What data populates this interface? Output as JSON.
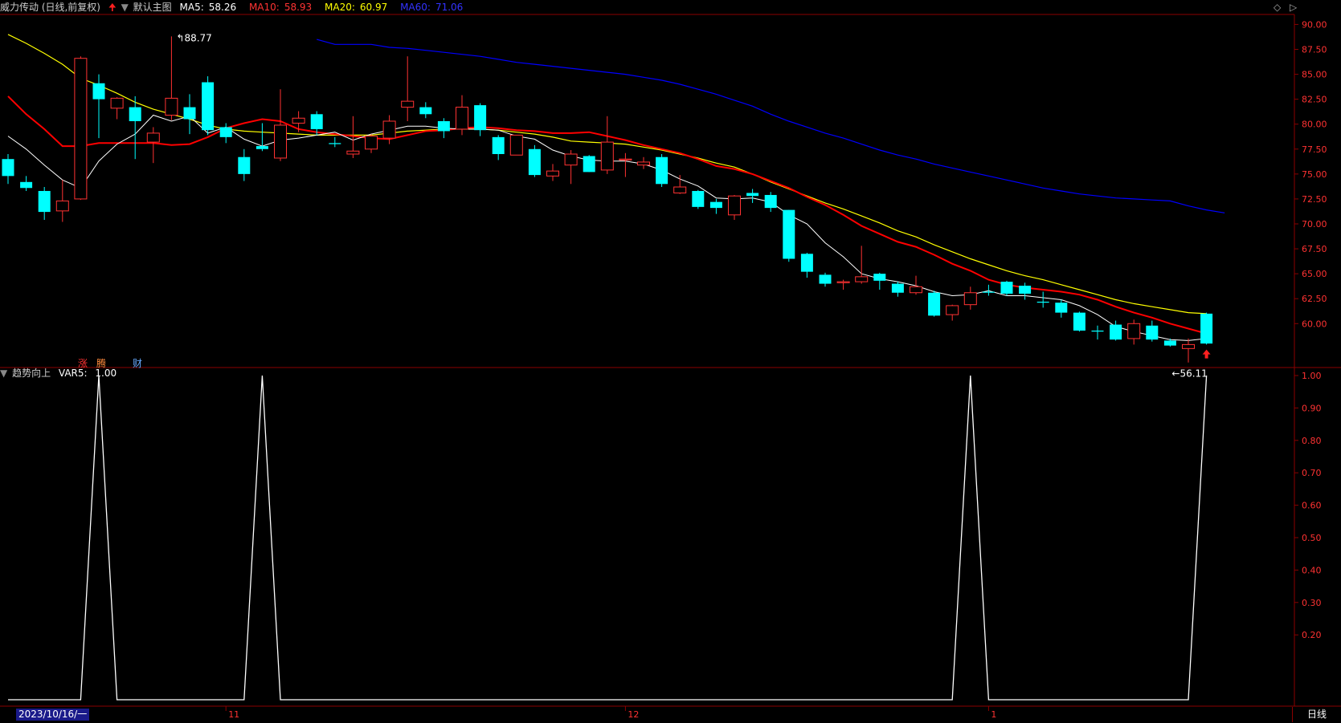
{
  "header": {
    "stock_name": "威力传动 (日线,前复权)",
    "main_label": "默认主图",
    "indicators": [
      {
        "label": "MA5:",
        "value": "58.26",
        "color": "#ffffff"
      },
      {
        "label": "MA10:",
        "value": "58.93",
        "color": "#ff3333"
      },
      {
        "label": "MA20:",
        "value": "60.97",
        "color": "#ffff00"
      },
      {
        "label": "MA60:",
        "value": "71.06",
        "color": "#3333ff"
      }
    ]
  },
  "sub_header": {
    "name": "趋势向上",
    "var_label": "VAR5:",
    "var_value": "1.00"
  },
  "markers": {
    "zhang": "涨",
    "teng": "腾",
    "cai": "财"
  },
  "footer": {
    "date": "2023/10/16/一",
    "period": "日线"
  },
  "colors": {
    "up": "#ff3232",
    "down": "#00ffff",
    "ma5": "#ffffff",
    "ma10": "#ff0000",
    "ma20": "#ffff00",
    "ma60": "#0000ff",
    "grid": "#8b0000"
  },
  "chart_data": [
    {
      "type": "candlestick",
      "y_ticks": [
        "90.00",
        "87.50",
        "85.00",
        "82.50",
        "80.00",
        "77.50",
        "75.00",
        "72.50",
        "70.00",
        "67.50",
        "65.00",
        "62.50",
        "60.00"
      ],
      "ylim": [
        56.0,
        91.0
      ],
      "annotations": [
        {
          "text": "88.77",
          "index": 9,
          "value": 88.77
        },
        {
          "text": "56.11",
          "index": 64,
          "value": 56.11
        }
      ],
      "x_labels": [
        {
          "text": "11",
          "index": 12
        },
        {
          "text": "12",
          "index": 34
        },
        {
          "text": "1",
          "index": 54
        }
      ],
      "candles": [
        [
          76.5,
          74.8,
          77.0,
          74.0
        ],
        [
          74.2,
          73.6,
          74.8,
          73.3
        ],
        [
          73.3,
          71.2,
          73.7,
          70.4
        ],
        [
          71.3,
          72.3,
          74.4,
          70.2
        ],
        [
          72.5,
          86.6,
          86.8,
          72.4
        ],
        [
          84.1,
          82.5,
          85.0,
          78.6
        ],
        [
          81.6,
          82.6,
          82.7,
          80.5
        ],
        [
          81.7,
          80.3,
          82.8,
          76.5
        ],
        [
          78.2,
          79.1,
          79.7,
          76.1
        ],
        [
          80.9,
          82.6,
          88.8,
          80.4
        ],
        [
          81.7,
          80.5,
          83.0,
          79.0
        ],
        [
          84.2,
          79.4,
          84.8,
          78.9
        ],
        [
          79.7,
          78.7,
          80.1,
          78.1
        ],
        [
          76.7,
          75.0,
          77.5,
          74.3
        ],
        [
          77.8,
          77.5,
          80.1,
          77.3
        ],
        [
          76.6,
          79.9,
          83.5,
          76.3
        ],
        [
          80.1,
          80.6,
          81.3,
          79.2
        ],
        [
          81.0,
          79.5,
          81.3,
          78.9
        ],
        [
          78.1,
          78.0,
          78.7,
          77.7
        ],
        [
          77.0,
          77.3,
          80.8,
          76.6
        ],
        [
          77.5,
          78.8,
          79.0,
          77.1
        ],
        [
          78.6,
          80.3,
          80.9,
          78.0
        ],
        [
          81.7,
          82.3,
          86.8,
          80.3
        ],
        [
          81.7,
          81.0,
          82.2,
          80.6
        ],
        [
          80.3,
          79.3,
          80.6,
          78.6
        ],
        [
          79.5,
          81.7,
          82.9,
          78.9
        ],
        [
          81.9,
          79.4,
          82.1,
          78.8
        ],
        [
          78.7,
          77.0,
          78.9,
          76.4
        ],
        [
          76.9,
          78.9,
          78.9,
          76.9
        ],
        [
          77.5,
          74.9,
          77.9,
          74.7
        ],
        [
          74.8,
          75.3,
          76.0,
          74.3
        ],
        [
          75.9,
          77.0,
          77.4,
          74.0
        ],
        [
          76.8,
          75.2,
          76.9,
          75.2
        ],
        [
          75.4,
          78.2,
          80.8,
          75.0
        ],
        [
          76.4,
          76.5,
          77.1,
          74.7
        ],
        [
          75.9,
          76.2,
          76.7,
          75.5
        ],
        [
          76.7,
          74.0,
          77.0,
          73.7
        ],
        [
          73.1,
          73.7,
          74.9,
          73.0
        ],
        [
          73.3,
          71.7,
          73.4,
          71.5
        ],
        [
          72.2,
          71.6,
          72.5,
          71.0
        ],
        [
          70.9,
          72.8,
          72.9,
          70.4
        ],
        [
          73.1,
          72.8,
          73.5,
          72.1
        ],
        [
          72.9,
          71.6,
          73.2,
          71.2
        ],
        [
          71.4,
          66.5,
          71.4,
          66.2
        ],
        [
          67.0,
          65.2,
          67.1,
          64.6
        ],
        [
          64.9,
          64.0,
          65.1,
          63.7
        ],
        [
          64.1,
          64.2,
          64.4,
          63.4
        ],
        [
          64.2,
          64.7,
          67.8,
          64.0
        ],
        [
          65.0,
          64.3,
          65.1,
          63.4
        ],
        [
          64.0,
          63.1,
          64.2,
          62.7
        ],
        [
          63.1,
          63.7,
          64.8,
          62.9
        ],
        [
          63.1,
          60.8,
          63.3,
          60.7
        ],
        [
          60.9,
          61.8,
          61.9,
          60.3
        ],
        [
          61.9,
          63.1,
          63.7,
          61.4
        ],
        [
          63.2,
          63.1,
          63.9,
          62.8
        ],
        [
          64.2,
          63.0,
          64.3,
          62.8
        ],
        [
          63.8,
          63.0,
          64.1,
          62.4
        ],
        [
          62.2,
          62.1,
          63.2,
          61.6
        ],
        [
          62.1,
          61.1,
          62.4,
          60.6
        ],
        [
          61.1,
          59.3,
          61.2,
          59.2
        ],
        [
          59.3,
          59.2,
          59.8,
          58.4
        ],
        [
          59.9,
          58.4,
          60.3,
          58.3
        ],
        [
          58.5,
          60.0,
          60.4,
          57.9
        ],
        [
          59.8,
          58.4,
          60.3,
          58.2
        ],
        [
          58.3,
          57.8,
          58.5,
          57.7
        ],
        [
          57.5,
          57.9,
          58.5,
          56.1
        ],
        [
          61.0,
          58.0,
          61.1,
          57.9
        ]
      ],
      "ma5": [
        78.8,
        77.5,
        75.9,
        74.4,
        73.6,
        76.3,
        78.0,
        79.0,
        80.9,
        80.3,
        80.8,
        79.1,
        79.7,
        78.5,
        77.8,
        78.4,
        78.6,
        78.9,
        79.2,
        78.4,
        79.0,
        79.4,
        79.8,
        79.8,
        79.6,
        79.5,
        79.5,
        79.4,
        78.8,
        78.5,
        77.4,
        76.8,
        76.4,
        76.3,
        76.3,
        76.0,
        75.4,
        74.5,
        73.8,
        72.6,
        72.5,
        72.6,
        72.2,
        70.9,
        70.0,
        68.1,
        66.7,
        65.0,
        64.5,
        64.2,
        63.8,
        63.2,
        62.8,
        62.9,
        63.3,
        62.8,
        62.8,
        62.6,
        62.4,
        61.8,
        60.9,
        59.7,
        59.2,
        58.8,
        58.4,
        58.3,
        58.5
      ],
      "ma10": [
        82.8,
        81.0,
        79.5,
        77.8,
        77.8,
        78.1,
        78.1,
        78.1,
        78.1,
        77.9,
        78.0,
        78.7,
        79.6,
        80.1,
        80.5,
        80.3,
        79.5,
        79.2,
        79.0,
        78.8,
        78.6,
        78.5,
        78.9,
        79.3,
        79.4,
        79.6,
        79.7,
        79.6,
        79.4,
        79.3,
        79.1,
        79.1,
        79.2,
        78.8,
        78.4,
        77.9,
        77.5,
        77.1,
        76.5,
        75.8,
        75.5,
        75.0,
        74.3,
        73.6,
        72.7,
        71.9,
        70.9,
        69.8,
        69.0,
        68.2,
        67.7,
        66.9,
        66.0,
        65.3,
        64.4,
        63.9,
        63.6,
        63.4,
        63.2,
        62.9,
        62.4,
        61.7,
        61.1,
        60.6,
        60.0,
        59.5,
        59.0
      ],
      "ma20": [
        89.0,
        88.1,
        87.1,
        86.0,
        84.6,
        83.9,
        83.1,
        82.2,
        81.5,
        81.0,
        80.5,
        79.9,
        79.5,
        79.3,
        79.2,
        79.1,
        79.0,
        78.9,
        78.9,
        78.9,
        78.9,
        79.1,
        79.3,
        79.4,
        79.5,
        79.5,
        79.5,
        79.4,
        79.2,
        79.0,
        78.7,
        78.3,
        78.2,
        78.1,
        78.0,
        77.7,
        77.4,
        77.0,
        76.6,
        76.1,
        75.7,
        75.0,
        74.2,
        73.5,
        72.8,
        72.1,
        71.5,
        70.8,
        70.1,
        69.3,
        68.7,
        67.9,
        67.2,
        66.5,
        65.9,
        65.3,
        64.8,
        64.4,
        63.9,
        63.4,
        62.9,
        62.4,
        62.0,
        61.7,
        61.4,
        61.1,
        61.0
      ],
      "ma60_start_index": 17,
      "ma60": [
        88.5,
        88.0,
        88.0,
        88.0,
        87.7,
        87.6,
        87.4,
        87.2,
        87.0,
        86.8,
        86.5,
        86.2,
        86.0,
        85.8,
        85.6,
        85.4,
        85.2,
        85.0,
        84.7,
        84.4,
        84.0,
        83.5,
        83.0,
        82.4,
        81.8,
        81.0,
        80.3,
        79.7,
        79.1,
        78.6,
        78.0,
        77.4,
        76.9,
        76.5,
        76.0,
        75.6,
        75.2,
        74.8,
        74.4,
        74.0,
        73.6,
        73.3,
        73.0,
        72.8,
        72.6,
        72.5,
        72.4,
        72.3,
        71.8,
        71.4,
        71.1
      ]
    },
    {
      "type": "line",
      "name": "VAR5",
      "y_ticks": [
        "1.00",
        "0.90",
        "0.80",
        "0.70",
        "0.60",
        "0.50",
        "0.40",
        "0.30",
        "0.20"
      ],
      "ylim": [
        0,
        1.0
      ],
      "values": [
        0,
        0,
        0,
        0,
        0,
        1,
        0,
        0,
        0,
        0,
        0,
        0,
        0,
        0,
        1,
        0,
        0,
        0,
        0,
        0,
        0,
        0,
        0,
        0,
        0,
        0,
        0,
        0,
        0,
        0,
        0,
        0,
        0,
        0,
        0,
        0,
        0,
        0,
        0,
        0,
        0,
        0,
        0,
        0,
        0,
        0,
        0,
        0,
        0,
        0,
        0,
        0,
        0,
        1,
        0,
        0,
        0,
        0,
        0,
        0,
        0,
        0,
        0,
        0,
        0,
        0,
        1
      ]
    }
  ]
}
